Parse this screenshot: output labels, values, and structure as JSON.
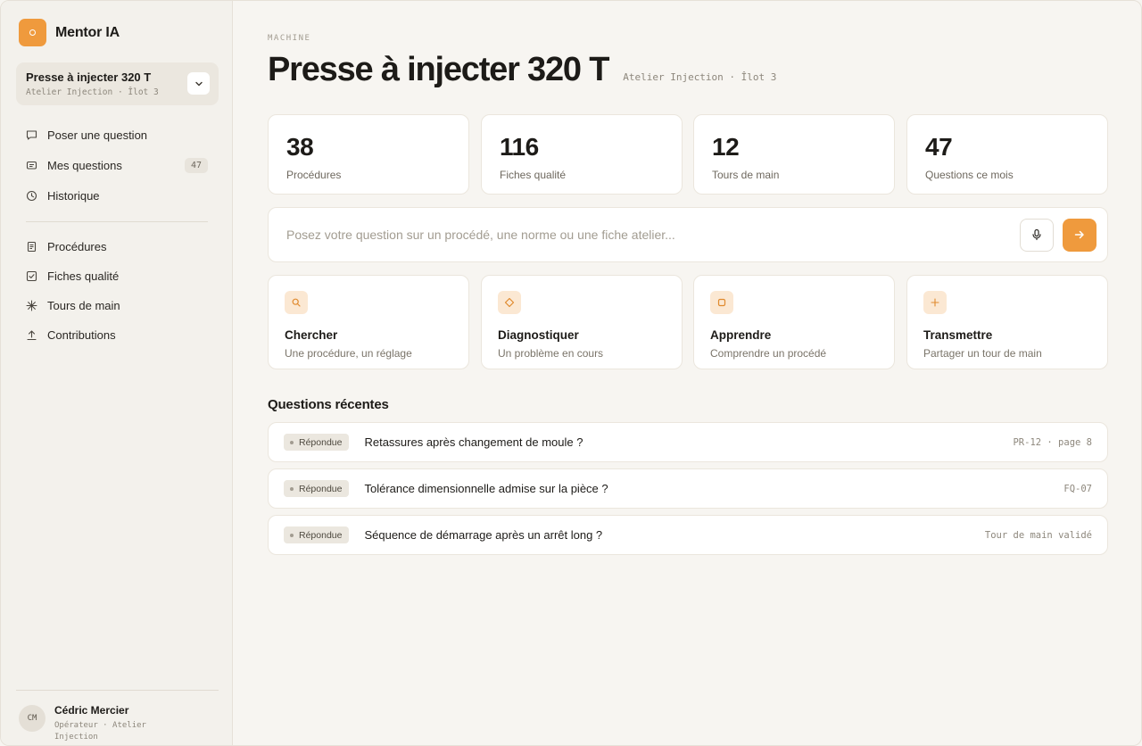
{
  "app": {
    "name": "Mentor IA"
  },
  "machine_selector": {
    "title": "Presse à injecter 320 T",
    "subtitle": "Atelier Injection · Îlot 3"
  },
  "nav_primary": [
    {
      "label": "Poser une question",
      "icon": "chat-bubble-icon"
    },
    {
      "label": "Mes questions",
      "icon": "message-icon",
      "badge": "47"
    },
    {
      "label": "Historique",
      "icon": "clock-icon"
    }
  ],
  "nav_secondary": [
    {
      "label": "Procédures",
      "icon": "document-icon"
    },
    {
      "label": "Fiches qualité",
      "icon": "checkbox-icon"
    },
    {
      "label": "Tours de main",
      "icon": "sparkle-icon"
    },
    {
      "label": "Contributions",
      "icon": "upload-icon"
    }
  ],
  "user": {
    "initials": "CM",
    "name": "Cédric Mercier",
    "role": "Opérateur · Atelier Injection"
  },
  "header": {
    "overline": "MACHINE",
    "title": "Presse à injecter 320 T",
    "subtitle": "Atelier Injection · Îlot 3"
  },
  "stats": [
    {
      "value": "38",
      "label": "Procédures"
    },
    {
      "value": "116",
      "label": "Fiches qualité"
    },
    {
      "value": "12",
      "label": "Tours de main"
    },
    {
      "value": "47",
      "label": "Questions ce mois"
    }
  ],
  "search": {
    "placeholder": "Posez votre question sur un procédé, une norme ou une fiche atelier...",
    "value": ""
  },
  "actions": [
    {
      "title": "Chercher",
      "subtitle": "Une procédure, un réglage",
      "icon": "search-icon"
    },
    {
      "title": "Diagnostiquer",
      "subtitle": "Un problème en cours",
      "icon": "diamond-icon"
    },
    {
      "title": "Apprendre",
      "subtitle": "Comprendre un procédé",
      "icon": "square-icon"
    },
    {
      "title": "Transmettre",
      "subtitle": "Partager un tour de main",
      "icon": "plus-icon"
    }
  ],
  "recent": {
    "title": "Questions récentes",
    "items": [
      {
        "status": "Répondue",
        "question": "Retassures après changement de moule ?",
        "ref": "PR-12 · page 8"
      },
      {
        "status": "Répondue",
        "question": "Tolérance dimensionnelle admise sur la pièce ?",
        "ref": "FQ-07"
      },
      {
        "status": "Répondue",
        "question": "Séquence de démarrage après un arrêt long ?",
        "ref": "Tour de main validé"
      }
    ]
  },
  "colors": {
    "accent": "#ef9a3d",
    "accent_soft": "#fbe8d3",
    "background": "#f7f5f1",
    "sidebar": "#f3f1ec"
  }
}
